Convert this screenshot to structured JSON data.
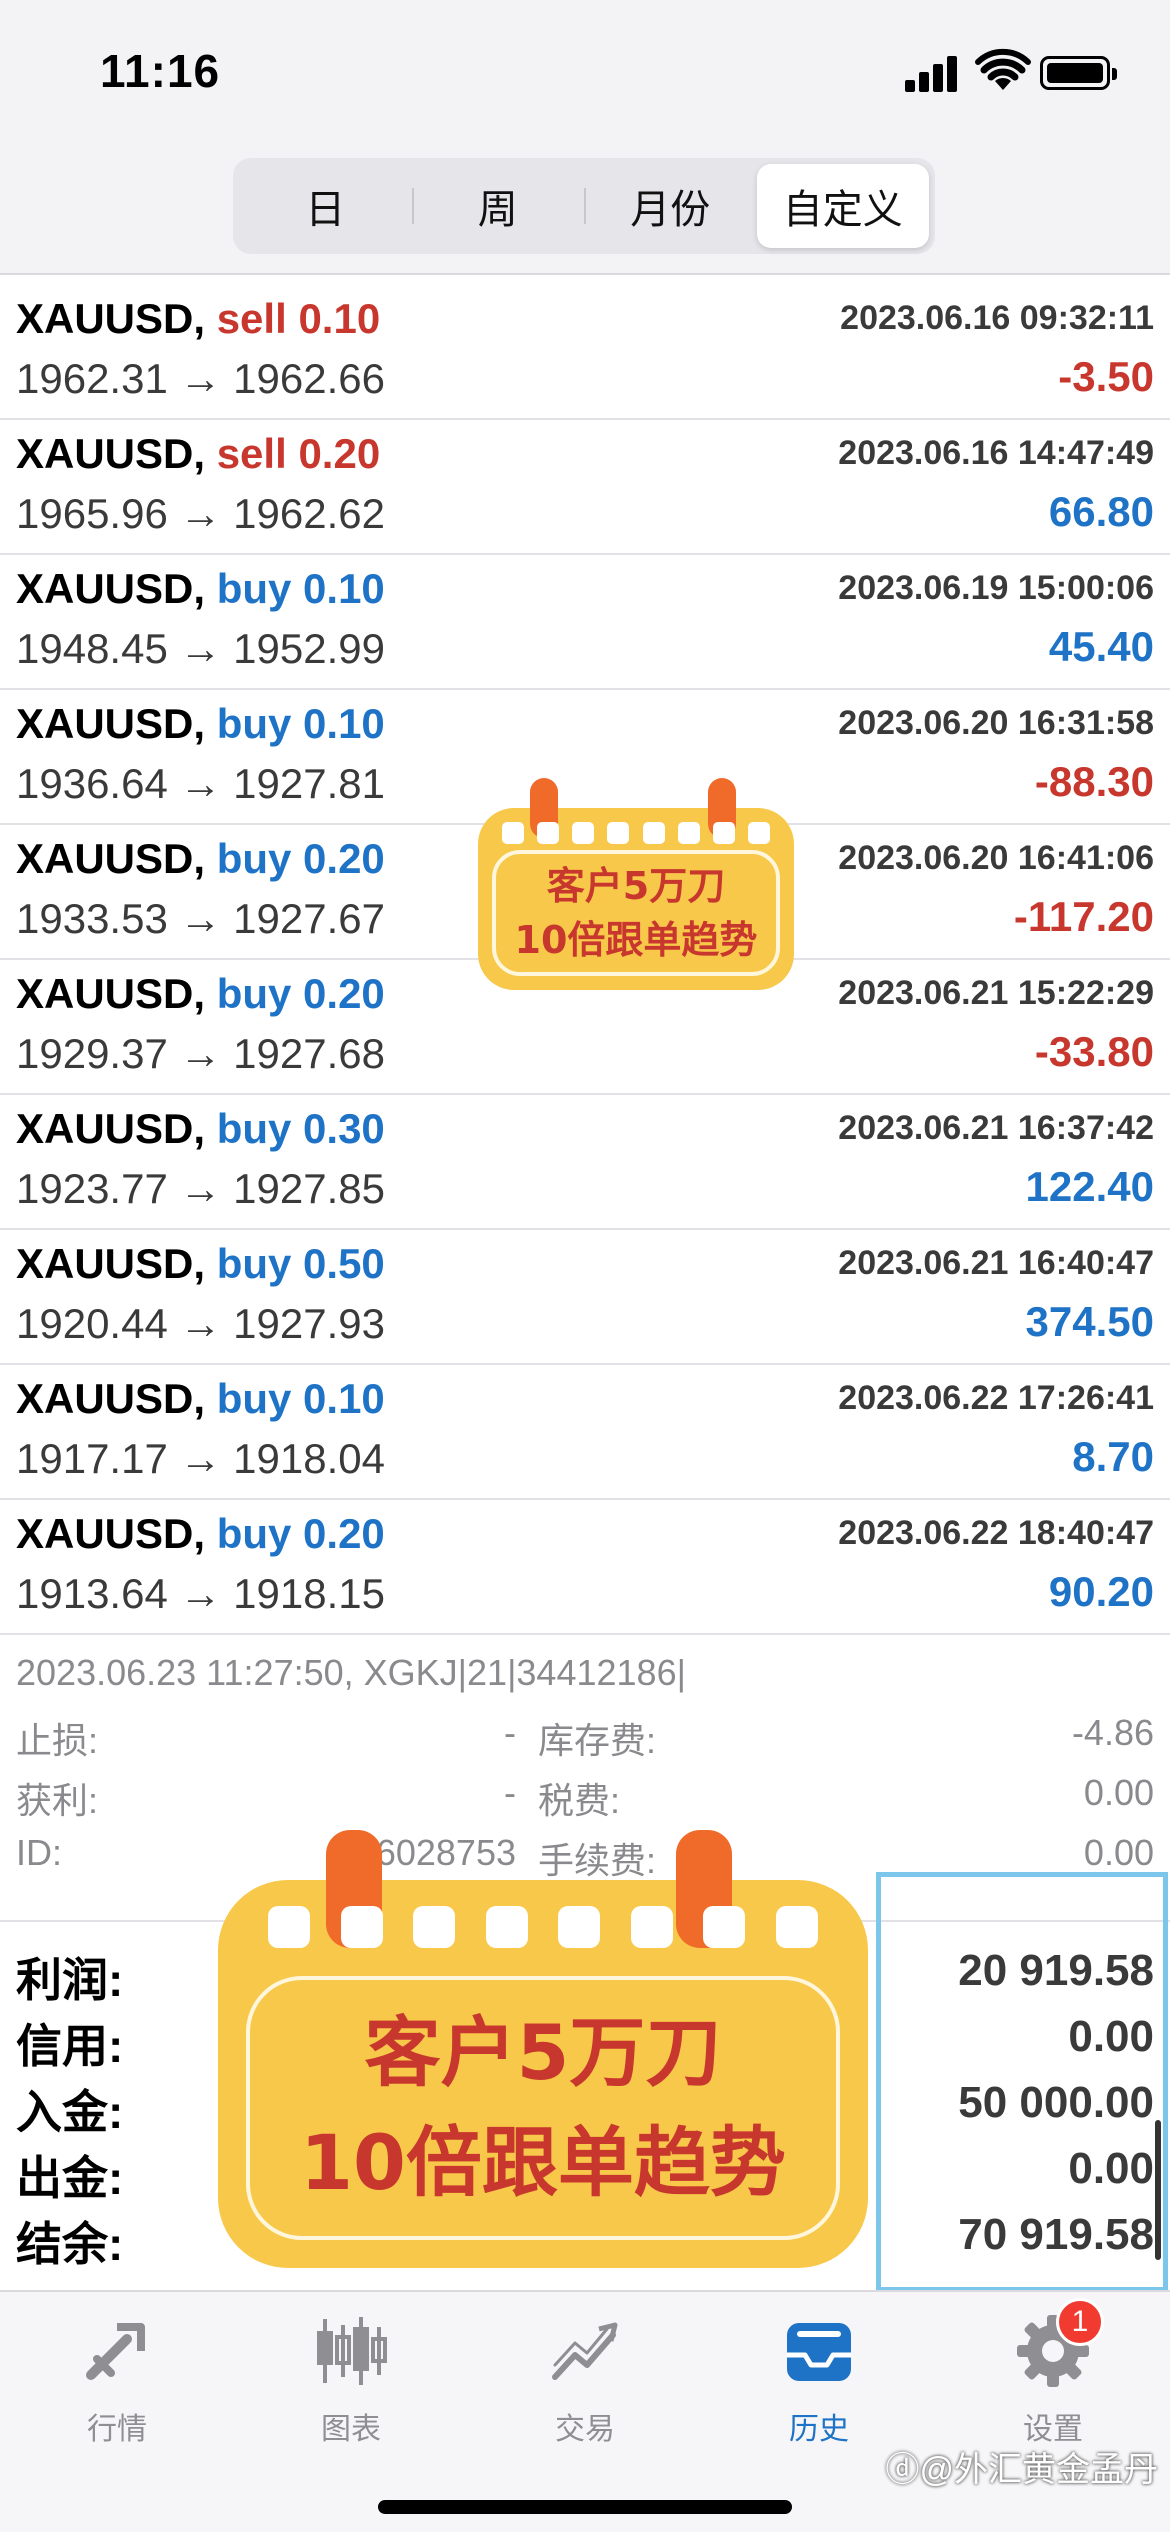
{
  "status_bar": {
    "time": "11:16"
  },
  "segments": [
    {
      "label": "日"
    },
    {
      "label": "周"
    },
    {
      "label": "月份"
    },
    {
      "label": "自定义",
      "active": true
    }
  ],
  "trades": [
    {
      "symbol": "XAUUSD,",
      "side": "sell",
      "lots": "0.10",
      "price_open": "1962.31",
      "price_close": "1962.66",
      "arrow": "→",
      "datetime": "2023.06.16 09:32:11",
      "profit": "-3.50",
      "sign": "neg"
    },
    {
      "symbol": "XAUUSD,",
      "side": "sell",
      "lots": "0.20",
      "price_open": "1965.96",
      "price_close": "1962.62",
      "arrow": "→",
      "datetime": "2023.06.16 14:47:49",
      "profit": "66.80",
      "sign": "pos"
    },
    {
      "symbol": "XAUUSD,",
      "side": "buy",
      "lots": "0.10",
      "price_open": "1948.45",
      "price_close": "1952.99",
      "arrow": "→",
      "datetime": "2023.06.19 15:00:06",
      "profit": "45.40",
      "sign": "pos"
    },
    {
      "symbol": "XAUUSD,",
      "side": "buy",
      "lots": "0.10",
      "price_open": "1936.64",
      "price_close": "1927.81",
      "arrow": "→",
      "datetime": "2023.06.20 16:31:58",
      "profit": "-88.30",
      "sign": "neg"
    },
    {
      "symbol": "XAUUSD,",
      "side": "buy",
      "lots": "0.20",
      "price_open": "1933.53",
      "price_close": "1927.67",
      "arrow": "→",
      "datetime": "2023.06.20 16:41:06",
      "profit": "-117.20",
      "sign": "neg"
    },
    {
      "symbol": "XAUUSD,",
      "side": "buy",
      "lots": "0.20",
      "price_open": "1929.37",
      "price_close": "1927.68",
      "arrow": "→",
      "datetime": "2023.06.21 15:22:29",
      "profit": "-33.80",
      "sign": "neg"
    },
    {
      "symbol": "XAUUSD,",
      "side": "buy",
      "lots": "0.30",
      "price_open": "1923.77",
      "price_close": "1927.85",
      "arrow": "→",
      "datetime": "2023.06.21 16:37:42",
      "profit": "122.40",
      "sign": "pos"
    },
    {
      "symbol": "XAUUSD,",
      "side": "buy",
      "lots": "0.50",
      "price_open": "1920.44",
      "price_close": "1927.93",
      "arrow": "→",
      "datetime": "2023.06.21 16:40:47",
      "profit": "374.50",
      "sign": "pos"
    },
    {
      "symbol": "XAUUSD,",
      "side": "buy",
      "lots": "0.10",
      "price_open": "1917.17",
      "price_close": "1918.04",
      "arrow": "→",
      "datetime": "2023.06.22 17:26:41",
      "profit": "8.70",
      "sign": "pos"
    },
    {
      "symbol": "XAUUSD,",
      "side": "buy",
      "lots": "0.20",
      "price_open": "1913.64",
      "price_close": "1918.15",
      "arrow": "→",
      "datetime": "2023.06.22 18:40:47",
      "profit": "90.20",
      "sign": "pos"
    }
  ],
  "detail": {
    "header": "2023.06.23 11:27:50, XGKJ|21|34412186|",
    "stop_loss_label": "止损:",
    "stop_loss_value": "-",
    "take_profit_label": "获利:",
    "take_profit_value": "-",
    "id_label": "ID:",
    "id_value": "106028753",
    "swap_label": "库存费:",
    "swap_value": "-4.86",
    "tax_label": "税费:",
    "tax_value": "0.00",
    "commission_label": "手续费:",
    "commission_value": "0.00"
  },
  "summary": {
    "profit_label": "利润:",
    "profit_value": "20 919.58",
    "credit_label": "信用:",
    "credit_value": "0.00",
    "deposit_label": "入金:",
    "deposit_value": "50 000.00",
    "withdrawal_label": "出金:",
    "withdrawal_value": "0.00",
    "balance_label": "结余:",
    "balance_value": "70 919.58"
  },
  "sticker": {
    "line1": "客户5万刀",
    "line2": "10倍跟单趋势"
  },
  "tabs": [
    {
      "label": "行情",
      "icon": "quotes-icon"
    },
    {
      "label": "图表",
      "icon": "chart-icon"
    },
    {
      "label": "交易",
      "icon": "trade-icon"
    },
    {
      "label": "历史",
      "icon": "history-icon",
      "active": true
    },
    {
      "label": "设置",
      "icon": "settings-icon",
      "badge": "1"
    }
  ],
  "watermark": "ⓓ@外汇黄金孟丹",
  "colors": {
    "sell": "#c8372d",
    "buy": "#1f73c6",
    "negative": "#c8372d",
    "positive": "#1f73c6",
    "accent": "#1f73c6",
    "badge": "#f23b30",
    "sticker": "#f8c84a"
  }
}
